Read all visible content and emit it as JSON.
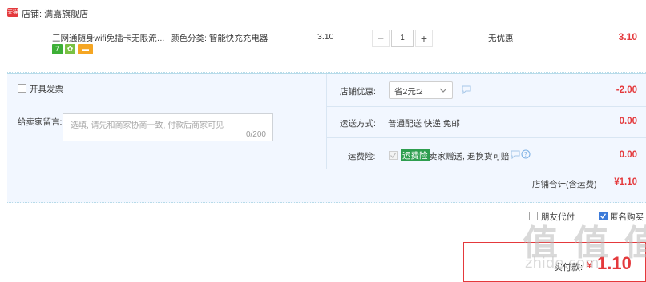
{
  "shop": {
    "icon_text": "天猫",
    "label": "店铺: 满嘉旗舰店"
  },
  "item": {
    "title": "三网通随身wifi免插卡无限流量...",
    "sku": "颜色分类: 智能快充充电器",
    "price": "3.10",
    "quantity": "1",
    "minus": "−",
    "plus": "+",
    "promo": "无优惠",
    "subtotal": "3.10",
    "badges": [
      {
        "text": "7",
        "color": "#3daf37"
      },
      {
        "text": "✿",
        "color": "#7ac143"
      },
      {
        "text": "▬",
        "color": "#f5a623"
      }
    ]
  },
  "invoice": {
    "label": "开具发票"
  },
  "message": {
    "label": "给卖家留言:",
    "placeholder": "选填, 请先和商家协商一致, 付款后商家可见",
    "counter": "0/200"
  },
  "shop_discount": {
    "label": "店铺优惠:",
    "selected": "省2元:2",
    "amount": "-2.00"
  },
  "shipping": {
    "label": "运送方式:",
    "value": "普通配送 快递 免邮",
    "amount": "0.00"
  },
  "insurance": {
    "label": "运费险:",
    "tag": "运费险",
    "text": "卖家赠送, 退换货可赔",
    "amount": "0.00"
  },
  "store_total": {
    "label": "店铺合计(含运费)",
    "amount": "¥1.10"
  },
  "options": {
    "friend_pay": "朋友代付",
    "anonymous": "匿名购买"
  },
  "pay": {
    "label": "实付款:",
    "currency": "¥",
    "amount": "1.10"
  },
  "watermark": {
    "brand": "值 值 值",
    "site": "zhide.com"
  },
  "colors": {
    "accent": "#e4393c",
    "panel": "#f2f7ff",
    "border": "#b7dbe9"
  }
}
